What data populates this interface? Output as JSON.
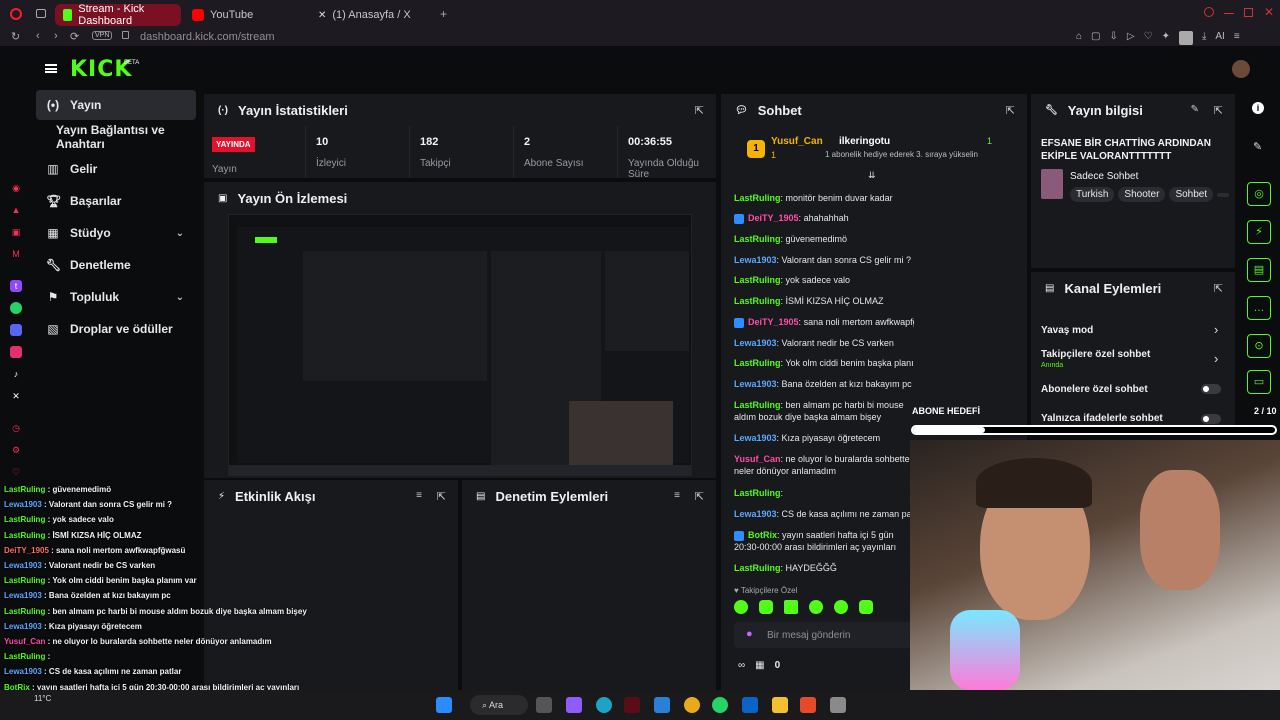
{
  "browser": {
    "tabs": [
      {
        "label": "Stream - Kick Dashboard",
        "active": true
      },
      {
        "label": "YouTube",
        "active": false
      },
      {
        "label": "(1) Anasayfa / X",
        "active": false
      }
    ],
    "vpn_label": "VPN",
    "url": "dashboard.kick.com/stream",
    "ai_label": "AI"
  },
  "app": {
    "logo": "KICK",
    "logo_badge": "BETA"
  },
  "sidebar": {
    "items": [
      {
        "label": "Yayın",
        "active": true
      },
      {
        "label": "Yayın Bağlantısı ve Anahtarı"
      },
      {
        "label": "Gelir"
      },
      {
        "label": "Başarılar"
      },
      {
        "label": "Stüdyo"
      },
      {
        "label": "Denetleme"
      },
      {
        "label": "Topluluk"
      },
      {
        "label": "Droplar ve ödüller"
      }
    ]
  },
  "stats": {
    "title": "Yayın İstatistikleri",
    "live_badge": "YAYINDA",
    "cells": [
      {
        "value": "",
        "label": "Yayın"
      },
      {
        "value": "10",
        "label": "İzleyici"
      },
      {
        "value": "182",
        "label": "Takipçi"
      },
      {
        "value": "2",
        "label": "Abone Sayısı"
      },
      {
        "value": "00:36:55",
        "label": "Yayında Olduğu Süre"
      }
    ]
  },
  "preview": {
    "title": "Yayın Ön İzlemesi"
  },
  "activity": {
    "title": "Etkinlik Akışı"
  },
  "moderation": {
    "title": "Denetim Eylemleri"
  },
  "chat": {
    "title": "Sohbet",
    "pinned_user": "Yusuf_Can",
    "pinned_count": "1",
    "pinned_gifter": "ilkeringotu",
    "pinned_gift_count": "1",
    "pinned_text": "1 abonelik hediye ederek 3. sıraya yükselin",
    "messages": [
      {
        "user": "LastRuling",
        "text": "monitör benim duvar kadar",
        "color": "green"
      },
      {
        "user": "DeiTY_1905",
        "text": "ahahahhah",
        "color": "pink"
      },
      {
        "user": "LastRuling",
        "text": "güvenemedimö",
        "color": "green"
      },
      {
        "user": "Lewa1903",
        "text": "Valorant dan sonra CS gelir mi ?",
        "color": "blue"
      },
      {
        "user": "LastRuling",
        "text": "yok sadece valo",
        "color": "green"
      },
      {
        "user": "LastRuling",
        "text": "İSMİ KIZSA HİÇ OLMAZ",
        "color": "green"
      },
      {
        "user": "DeiTY_1905",
        "text": "sana noli mertom awfkwapfğwasü",
        "color": "pink"
      },
      {
        "user": "Lewa1903",
        "text": "Valorant nedir be CS varken",
        "color": "blue"
      },
      {
        "user": "LastRuling",
        "text": "Yok olm ciddi benim başka planım var",
        "color": "green"
      },
      {
        "user": "Lewa1903",
        "text": "Bana özelden at kızı bakayım pc",
        "color": "blue"
      },
      {
        "user": "LastRuling",
        "text": "ben almam pc harbi bi mouse aldım bozuk diye başka almam bişey",
        "color": "green"
      },
      {
        "user": "Lewa1903",
        "text": "Kıza piyasayı öğretecem",
        "color": "blue"
      },
      {
        "user": "Yusuf_Can",
        "text": "ne oluyor lo buralarda sohbette neler dönüyor anlamadım",
        "color": "pink"
      },
      {
        "user": "LastRuling",
        "text": "",
        "color": "green"
      },
      {
        "user": "Lewa1903",
        "text": "CS de kasa açılımı ne zaman patlar",
        "color": "blue"
      },
      {
        "user": "BotRix",
        "text": "yayın saatleri hafta içi 5 gün 20:30-00:00 arası bildirimleri aç yayınları kaçırma",
        "color": "green"
      },
      {
        "user": "LastRuling",
        "text": "HAYDEĞĞĞ",
        "color": "green"
      }
    ],
    "followers_only_label": "Takipçilere Özel",
    "input_placeholder": "Bir mesaj gönderin",
    "viewer_count_label": "0"
  },
  "stream_info": {
    "title": "Yayın bilgisi",
    "stream_title": "EFSANE BİR CHATTİNG ARDINDAN EKİPLE VALORANTTTTTTT",
    "category": "Sadece Sohbet",
    "tags": [
      "Turkish",
      "Shooter",
      "Sohbet"
    ]
  },
  "channel_actions": {
    "title": "Kanal Eylemleri",
    "items": [
      {
        "label": "Yavaş mod",
        "sub": ""
      },
      {
        "label": "Takipçilere özel sohbet",
        "sub": "Anında"
      },
      {
        "label": "Abonelere özel sohbet",
        "sub": ""
      },
      {
        "label": "Yalnızca ifadelerle sohbet",
        "sub": ""
      }
    ]
  },
  "overlay": {
    "sub_goal_label": "ABONE HEDEFİ",
    "sub_goal_count": "2 / 10",
    "sub_goal_progress": 0.2,
    "chat": [
      {
        "user": "LastRuling",
        "text": "güvenemedimö",
        "color": "green"
      },
      {
        "user": "Lewa1903",
        "text": "Valorant dan sonra CS gelir mi ?",
        "color": "blue"
      },
      {
        "user": "LastRuling",
        "text": "yok sadece valo",
        "color": "green"
      },
      {
        "user": "LastRuling",
        "text": "İSMİ KIZSA HİÇ OLMAZ",
        "color": "green"
      },
      {
        "user": "DeiTY_1905",
        "text": "sana noli mertom awfkwapfğwasü",
        "color": "red"
      },
      {
        "user": "Lewa1903",
        "text": "Valorant nedir be CS varken",
        "color": "blue"
      },
      {
        "user": "LastRuling",
        "text": "Yok olm ciddi benim başka planım var",
        "color": "green"
      },
      {
        "user": "Lewa1903",
        "text": "Bana özelden at kızı bakayım pc",
        "color": "blue"
      },
      {
        "user": "LastRuling",
        "text": "ben almam pc harbi bi mouse aldım bozuk diye başka almam bişey",
        "color": "green"
      },
      {
        "user": "Lewa1903",
        "text": "Kıza piyasayı öğretecem",
        "color": "blue"
      },
      {
        "user": "Yusuf_Can",
        "text": "ne oluyor lo buralarda sohbette neler dönüyor anlamadım",
        "color": "pink"
      },
      {
        "user": "LastRuling",
        "text": "",
        "color": "green"
      },
      {
        "user": "Lewa1903",
        "text": "CS de kasa açılımı ne zaman patlar",
        "color": "blue"
      },
      {
        "user": "BotRix",
        "text": "yayın saatleri hafta içi 5 gün 20:30-00:00 arası bildirimleri aç yayınları",
        "color": "green"
      }
    ]
  },
  "taskbar": {
    "weather": "11°C",
    "search_label": "Ara"
  }
}
